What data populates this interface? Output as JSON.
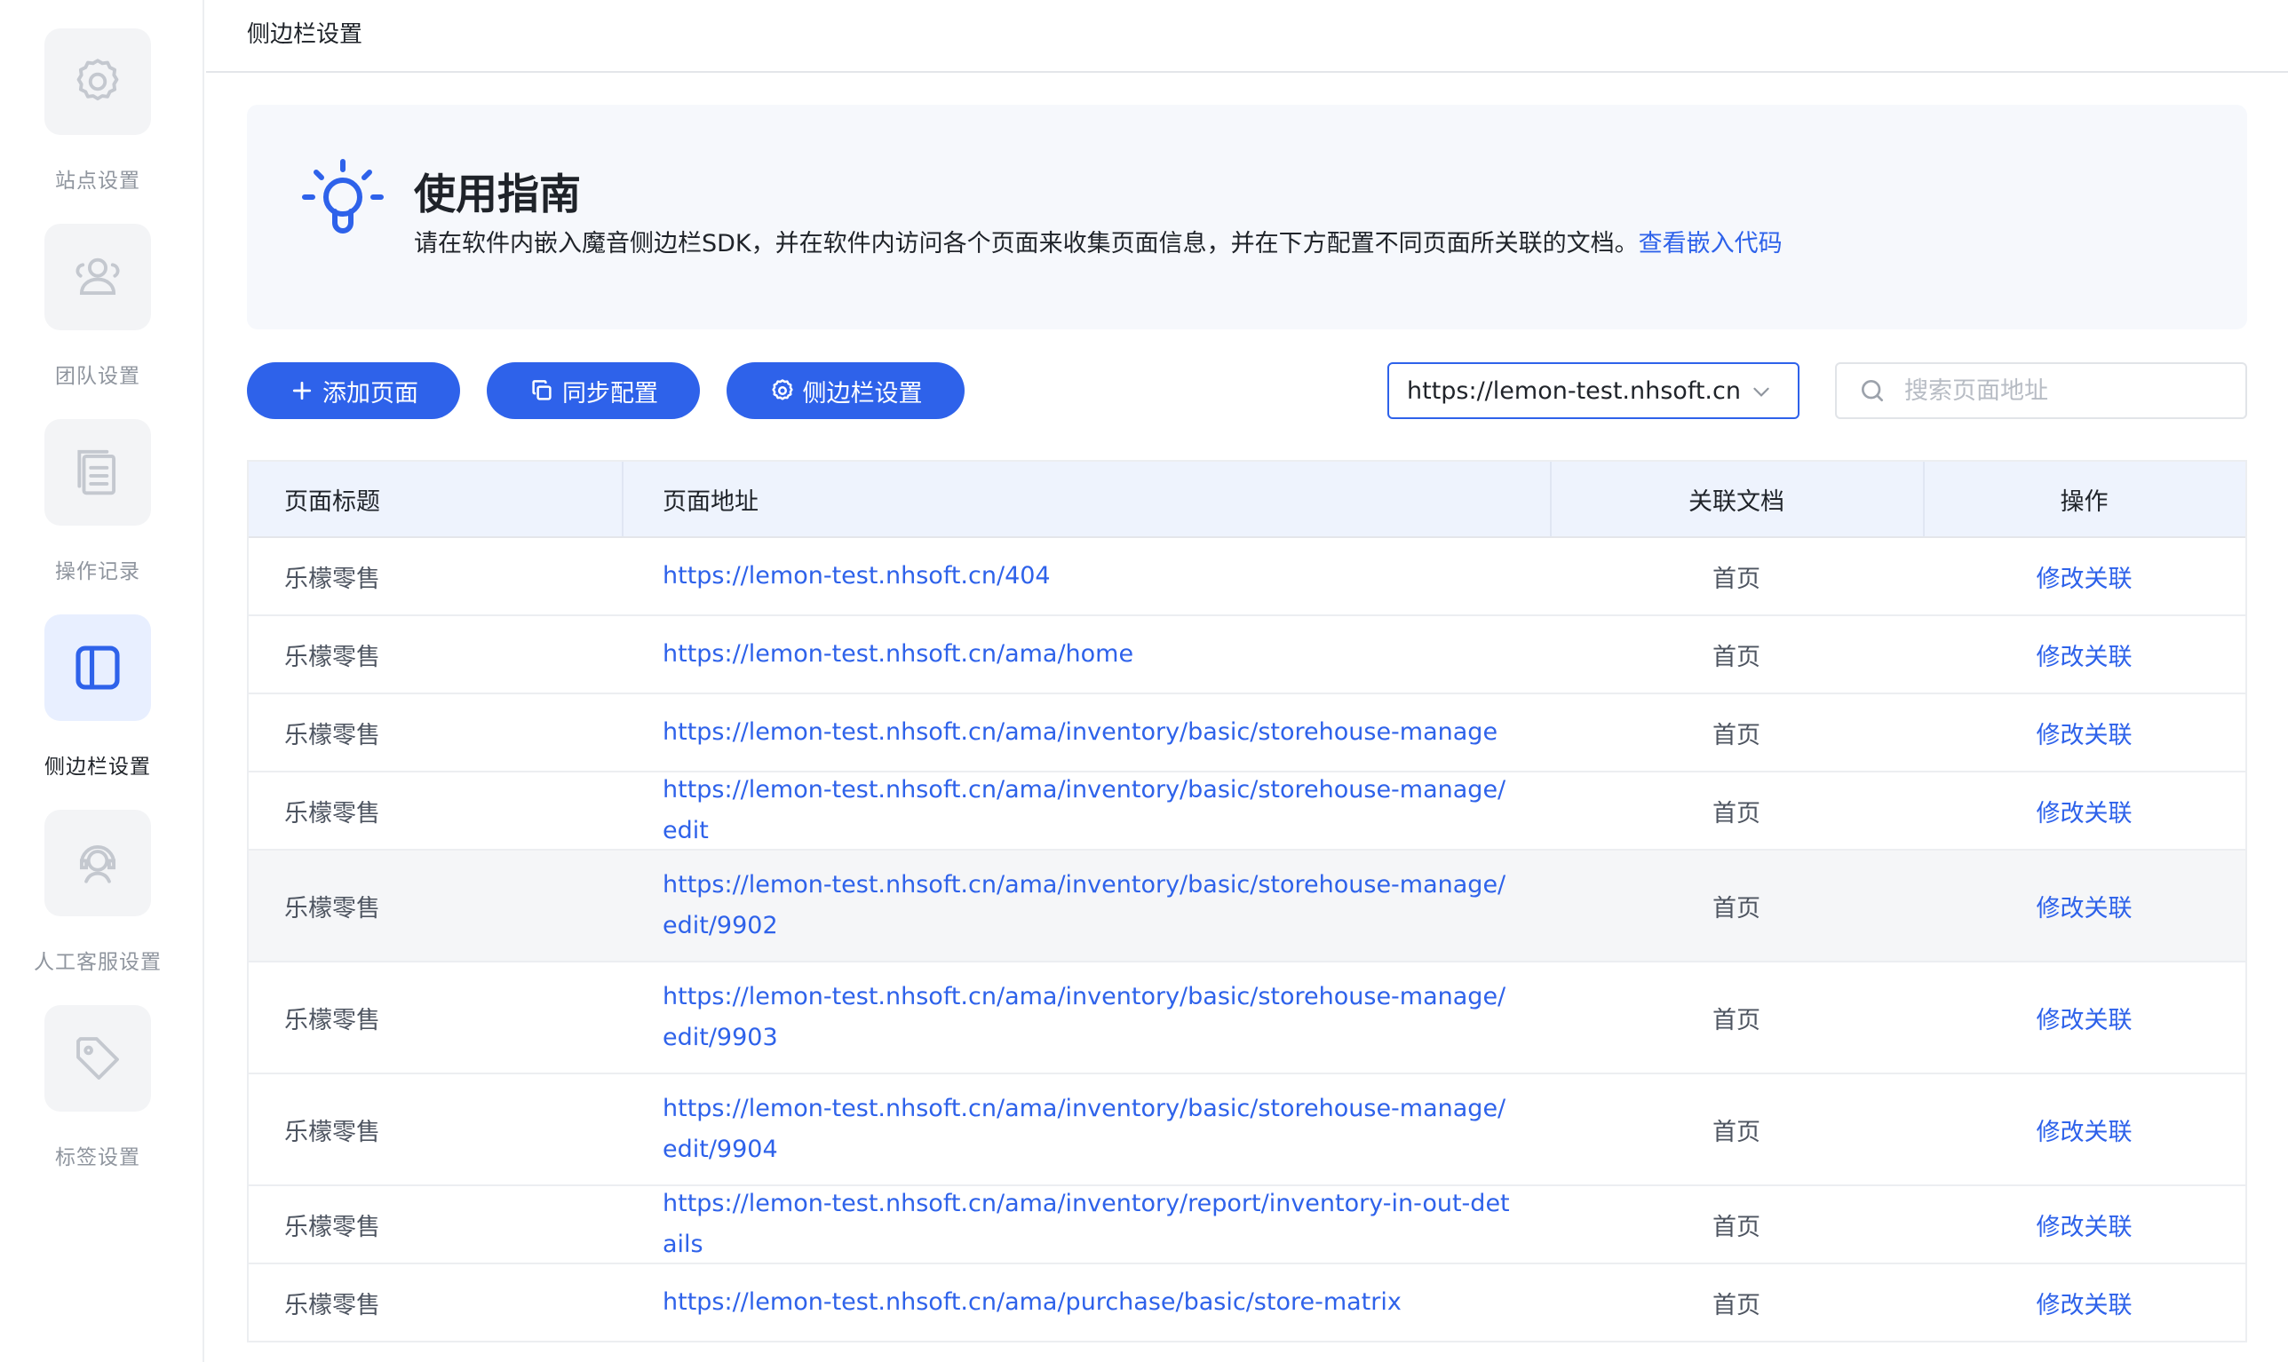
{
  "sidebar": {
    "items": [
      {
        "label": "站点设置",
        "icon": "gear-icon"
      },
      {
        "label": "团队设置",
        "icon": "team-icon"
      },
      {
        "label": "操作记录",
        "icon": "document-icon"
      },
      {
        "label": "侧边栏设置",
        "icon": "sidebar-icon",
        "active": true
      },
      {
        "label": "人工客服设置",
        "icon": "headset-icon"
      },
      {
        "label": "标签设置",
        "icon": "tag-icon"
      }
    ]
  },
  "header": {
    "title": "侧边栏设置"
  },
  "guide": {
    "title": "使用指南",
    "description": "请在软件内嵌入魔音侧边栏SDK，并在软件内访问各个页面来收集页面信息，并在下方配置不同页面所关联的文档。",
    "link": "查看嵌入代码"
  },
  "toolbar": {
    "add_label": "添加页面",
    "sync_label": "同步配置",
    "sidebar_settings_label": "侧边栏设置",
    "site_select_value": "https://lemon-test.nhsoft.cn",
    "search_placeholder": "搜索页面地址"
  },
  "table": {
    "headers": [
      "页面标题",
      "页面地址",
      "关联文档",
      "操作"
    ],
    "rows": [
      {
        "title": "乐檬零售",
        "url": "https://lemon-test.nhsoft.cn/404",
        "doc": "首页",
        "action": "修改关联"
      },
      {
        "title": "乐檬零售",
        "url": "https://lemon-test.nhsoft.cn/ama/home",
        "doc": "首页",
        "action": "修改关联"
      },
      {
        "title": "乐檬零售",
        "url": "https://lemon-test.nhsoft.cn/ama/inventory/basic/storehouse-manage",
        "doc": "首页",
        "action": "修改关联"
      },
      {
        "title": "乐檬零售",
        "url": "https://lemon-test.nhsoft.cn/ama/inventory/basic/storehouse-manage/edit",
        "doc": "首页",
        "action": "修改关联"
      },
      {
        "title": "乐檬零售",
        "url": "https://lemon-test.nhsoft.cn/ama/inventory/basic/storehouse-manage/edit/9902",
        "doc": "首页",
        "action": "修改关联"
      },
      {
        "title": "乐檬零售",
        "url": "https://lemon-test.nhsoft.cn/ama/inventory/basic/storehouse-manage/edit/9903",
        "doc": "首页",
        "action": "修改关联"
      },
      {
        "title": "乐檬零售",
        "url": "https://lemon-test.nhsoft.cn/ama/inventory/basic/storehouse-manage/edit/9904",
        "doc": "首页",
        "action": "修改关联"
      },
      {
        "title": "乐檬零售",
        "url": "https://lemon-test.nhsoft.cn/ama/inventory/report/inventory-in-out-details",
        "doc": "首页",
        "action": "修改关联"
      },
      {
        "title": "乐檬零售",
        "url": "https://lemon-test.nhsoft.cn/ama/purchase/basic/store-matrix",
        "doc": "首页",
        "action": "修改关联"
      }
    ]
  },
  "colors": {
    "accent": "#2e62ea",
    "table_header_bg": "#eef3fd",
    "guide_bg": "#f6f8fc"
  }
}
